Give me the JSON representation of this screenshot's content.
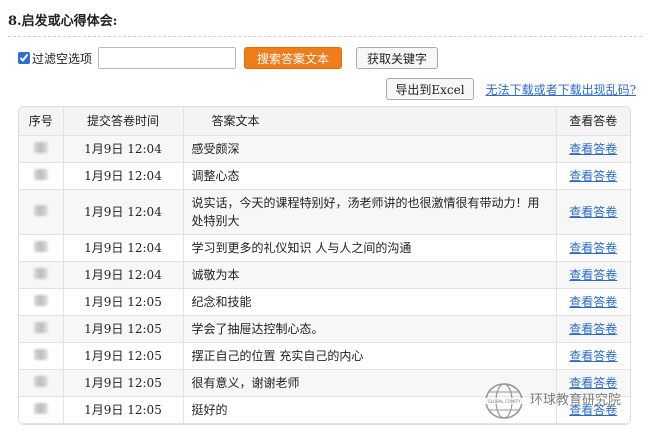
{
  "question": {
    "title": "8.启发或心得体会:"
  },
  "filter": {
    "checkbox_label": "过滤空选项",
    "checked": true,
    "search_value": "",
    "search_button": "搜索答案文本",
    "keyword_button": "获取关键字"
  },
  "export": {
    "export_button": "导出到Excel",
    "help_link": "无法下载或者下载出现乱码?"
  },
  "table": {
    "headers": {
      "index": "序号",
      "time": "提交答卷时间",
      "text": "答案文本",
      "view": "查看答卷"
    },
    "rows": [
      {
        "time": "1月9日 12:04",
        "text": "感受颇深",
        "view": "查看答卷"
      },
      {
        "time": "1月9日 12:04",
        "text": "调整心态",
        "view": "查看答卷"
      },
      {
        "time": "1月9日 12:04",
        "text": "说实话，今天的课程特别好，汤老师讲的也很激情很有带动力！用处特别大",
        "view": "查看答卷"
      },
      {
        "time": "1月9日 12:04",
        "text": "学习到更多的礼仪知识 人与人之间的沟通",
        "view": "查看答卷"
      },
      {
        "time": "1月9日 12:04",
        "text": "诚敬为本",
        "view": "查看答卷"
      },
      {
        "time": "1月9日 12:05",
        "text": "纪念和技能",
        "view": "查看答卷"
      },
      {
        "time": "1月9日 12:05",
        "text": "学会了抽屉达控制心态。",
        "view": "查看答卷"
      },
      {
        "time": "1月9日 12:05",
        "text": "摆正自己的位置 充实自己的内心",
        "view": "查看答卷"
      },
      {
        "time": "1月9日 12:05",
        "text": "很有意义，谢谢老师",
        "view": "查看答卷"
      },
      {
        "time": "1月9日 12:05",
        "text": "挺好的",
        "view": "查看答卷"
      }
    ]
  },
  "watermark": {
    "text": "环球教育研究院",
    "globe_text": "GLOBAL COMITY"
  }
}
